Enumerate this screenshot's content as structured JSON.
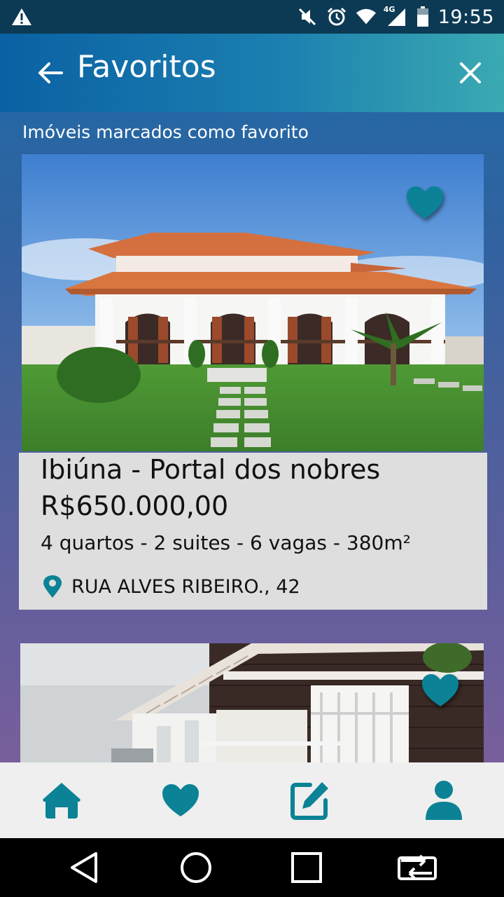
{
  "status_bar": {
    "time": "19:55",
    "network": "4G",
    "icons": [
      "warning-icon",
      "mute-icon",
      "alarm-icon",
      "wifi-icon",
      "signal-icon",
      "battery-icon"
    ]
  },
  "header": {
    "title": "Favoritos",
    "back_icon": "arrow-left-icon",
    "close_icon": "close-icon"
  },
  "subtitle": "Imóveis marcados como favorito",
  "listings": [
    {
      "title": "Ibiúna - Portal dos nobres",
      "price": "R$650.000,00",
      "details": "4 quartos - 2 suites - 6 vagas - 380m²",
      "address": "RUA ALVES RIBEIRO., 42",
      "favorited": true
    },
    {
      "favorited": true
    }
  ],
  "bottom_nav": [
    {
      "icon": "home-icon"
    },
    {
      "icon": "heart-icon"
    },
    {
      "icon": "edit-icon"
    },
    {
      "icon": "user-icon"
    }
  ],
  "colors": {
    "accent": "#0b8295",
    "status_bar": "#0c3a55",
    "panel": "#dedede",
    "nav_bg": "#efefef"
  }
}
